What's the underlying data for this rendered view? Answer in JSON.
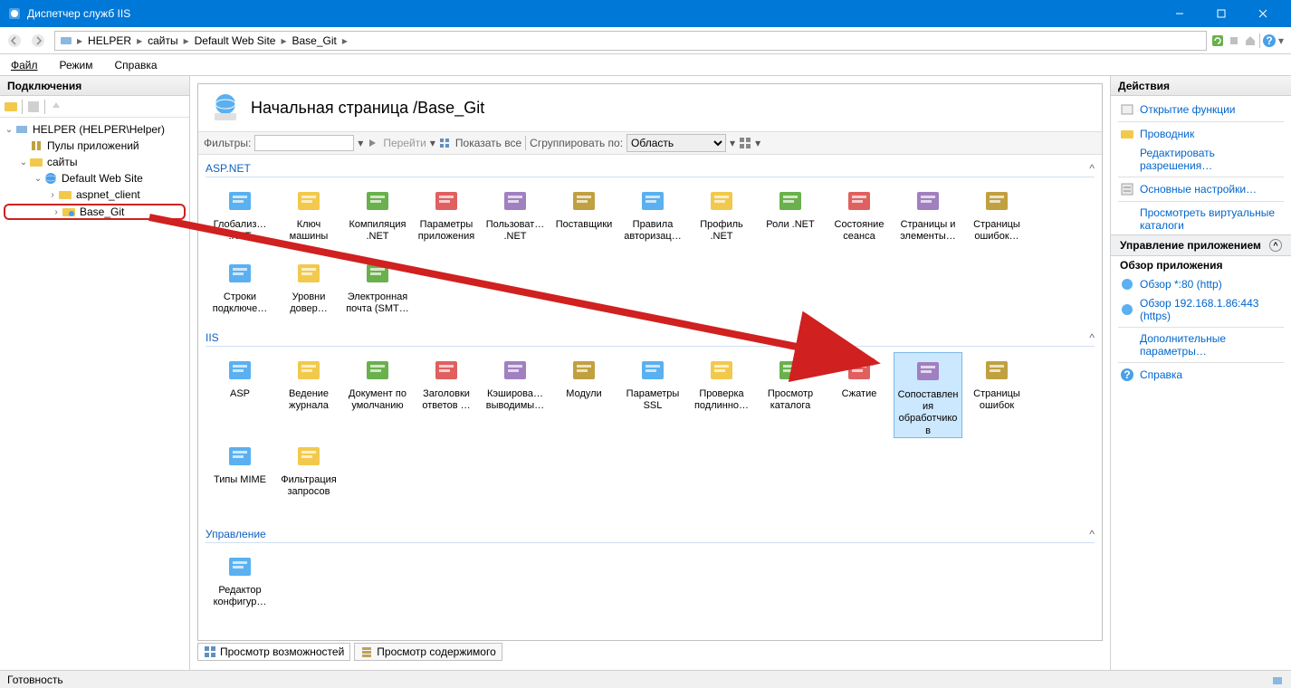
{
  "window": {
    "title": "Диспетчер служб IIS"
  },
  "breadcrumb": [
    "HELPER",
    "сайты",
    "Default Web Site",
    "Base_Git"
  ],
  "menu": {
    "file": "Файл",
    "mode": "Режим",
    "help": "Справка"
  },
  "panels": {
    "connections": "Подключения",
    "actions": "Действия"
  },
  "tree": {
    "server": "HELPER (HELPER\\Helper)",
    "app_pools": "Пулы приложений",
    "sites": "сайты",
    "default_site": "Default Web Site",
    "aspnet_client": "aspnet_client",
    "base_git": "Base_Git"
  },
  "page": {
    "title": "Начальная страница /Base_Git"
  },
  "filter": {
    "label": "Фильтры:",
    "go": "Перейти",
    "showall": "Показать все",
    "groupby": "Сгруппировать по:",
    "groupvalue": "Область"
  },
  "groups": {
    "aspnet": "ASP.NET",
    "iis": "IIS",
    "management": "Управление"
  },
  "aspnet_items": [
    "Глобализ… .NET",
    "Ключ машины",
    "Компиляция .NET",
    "Параметры приложения",
    "Пользоват… .NET",
    "Поставщики",
    "Правила авторизац…",
    "Профиль .NET",
    "Роли .NET",
    "Состояние сеанса",
    "Страницы и элементы…",
    "Страницы ошибок…",
    "Строки подключе…",
    "Уровни довер…",
    "Электронная почта (SMT…"
  ],
  "iis_items": [
    "ASP",
    "Ведение журнала",
    "Документ по умолчанию",
    "Заголовки ответов …",
    "Кэширова… выводимы…",
    "Модули",
    "Параметры SSL",
    "Проверка подлинно…",
    "Просмотр каталога",
    "Сжатие",
    "Сопоставления обработчиков",
    "Страницы ошибок",
    "Типы MIME",
    "Фильтрация запросов"
  ],
  "mgmt_items": [
    "Редактор конфигур…"
  ],
  "tabs": {
    "features": "Просмотр возможностей",
    "content": "Просмотр содержимого"
  },
  "actions": {
    "open_feature": "Открытие функции",
    "explorer": "Проводник",
    "edit_perms": "Редактировать разрешения…",
    "basic_settings": "Основные настройки…",
    "view_vdirs": "Просмотреть виртуальные каталоги",
    "manage_app": "Управление приложением",
    "browse_app": "Обзор приложения",
    "browse80": "Обзор *:80 (http)",
    "browse443": "Обзор 192.168.1.86:443 (https)",
    "advanced": "Дополнительные параметры…",
    "help": "Справка"
  },
  "status": "Готовность"
}
